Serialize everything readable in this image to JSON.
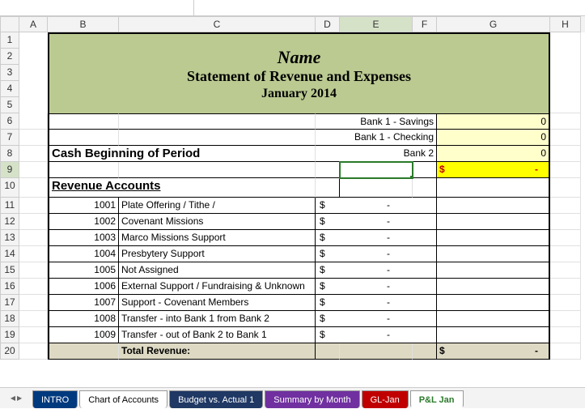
{
  "columns": [
    "A",
    "B",
    "C",
    "D",
    "E",
    "F",
    "G",
    "H"
  ],
  "active_col": "E",
  "active_row": 9,
  "title": {
    "line1": "Name",
    "line2": "Statement of Revenue and Expenses",
    "line3": "January  2014"
  },
  "banks": [
    {
      "label": "Bank 1 - Savings",
      "value": "0"
    },
    {
      "label": "Bank 1 - Checking",
      "value": "0"
    },
    {
      "label": "Bank 2",
      "value": "0"
    }
  ],
  "cash_beginning_label": "Cash Beginning of Period",
  "cash_total": {
    "dollar": "$",
    "value": "-"
  },
  "revenue_header": "Revenue Accounts",
  "revenue": [
    {
      "code": "1001",
      "desc": "Plate Offering / Tithe /",
      "d": "$",
      "amt": "-"
    },
    {
      "code": "1002",
      "desc": "Covenant Missions",
      "d": "$",
      "amt": "-"
    },
    {
      "code": "1003",
      "desc": "Marco Missions Support",
      "d": "$",
      "amt": "-"
    },
    {
      "code": "1004",
      "desc": "Presbytery Support",
      "d": "$",
      "amt": "-"
    },
    {
      "code": "1005",
      "desc": "Not Assigned",
      "d": "$",
      "amt": "-"
    },
    {
      "code": "1006",
      "desc": "External Support / Fundraising & Unknown",
      "d": "$",
      "amt": "-"
    },
    {
      "code": "1007",
      "desc": "Support - Covenant Members",
      "d": "$",
      "amt": "-"
    },
    {
      "code": "1008",
      "desc": "Transfer - into Bank 1 from Bank 2",
      "d": "$",
      "amt": "-"
    },
    {
      "code": "1009",
      "desc": "Transfer - out of Bank 2 to Bank 1",
      "d": "$",
      "amt": "-"
    }
  ],
  "total_revenue": {
    "label": "Total Revenue:",
    "d": "$",
    "amt": "-"
  },
  "tabs": [
    {
      "label": "INTRO",
      "cls": "blue"
    },
    {
      "label": "Chart of Accounts",
      "cls": "white"
    },
    {
      "label": "Budget vs. Actual 1",
      "cls": "navy"
    },
    {
      "label": "Summary by Month",
      "cls": "purple"
    },
    {
      "label": "GL-Jan",
      "cls": "red"
    },
    {
      "label": "P&L Jan",
      "cls": "green-active"
    }
  ]
}
